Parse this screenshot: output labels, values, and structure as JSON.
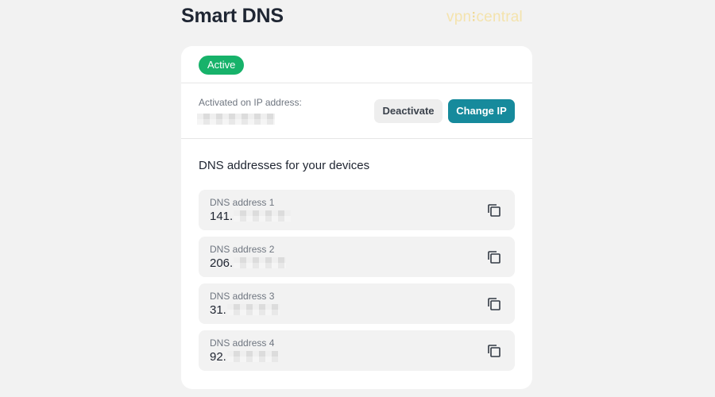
{
  "header": {
    "title": "Smart DNS",
    "watermark_left": "vpn",
    "watermark_right": "central"
  },
  "status": {
    "badge": "Active"
  },
  "ip_section": {
    "label": "Activated on IP address:",
    "deactivate_label": "Deactivate",
    "change_ip_label": "Change IP"
  },
  "dns_section": {
    "title": "DNS addresses for your devices",
    "items": [
      {
        "label": "DNS address 1",
        "value_prefix": "141."
      },
      {
        "label": "DNS address 2",
        "value_prefix": "206."
      },
      {
        "label": "DNS address 3",
        "value_prefix": "31."
      },
      {
        "label": "DNS address 4",
        "value_prefix": "92."
      }
    ]
  },
  "icons": {
    "copy": "copy-icon"
  },
  "colors": {
    "active": "#17b26a",
    "primary": "#168a9c"
  }
}
